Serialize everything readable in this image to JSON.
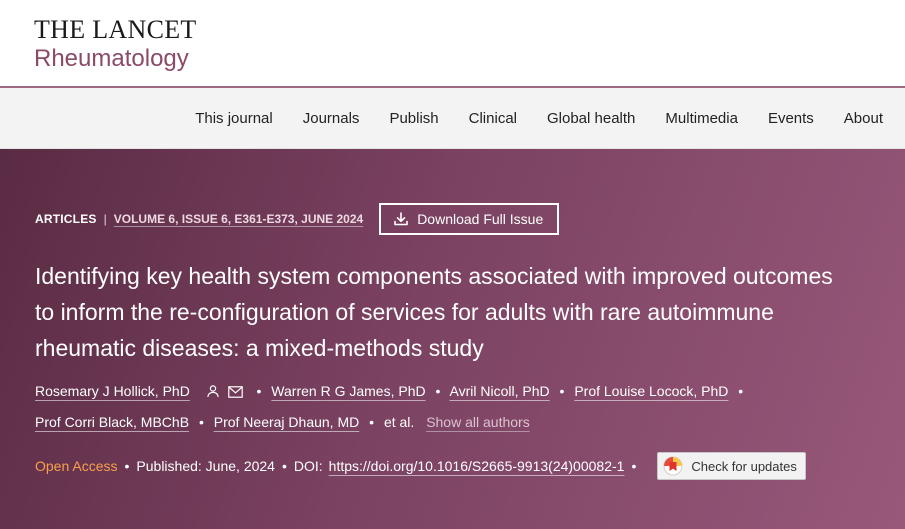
{
  "logo": {
    "top": "THE LANCET",
    "sub": "Rheumatology"
  },
  "nav": {
    "items": [
      "This journal",
      "Journals",
      "Publish",
      "Clinical",
      "Global health",
      "Multimedia",
      "Events",
      "About"
    ]
  },
  "article": {
    "type": "ARTICLES",
    "issue": "VOLUME 6, ISSUE 6, E361-E373, JUNE 2024",
    "download_label": "Download Full Issue",
    "title": "Identifying key health system components associated with improved outcomes to inform the re-configuration of services for adults with rare autoimmune rheumatic diseases: a mixed-methods study",
    "authors": [
      "Rosemary J Hollick, PhD",
      "Warren R G James, PhD",
      "Avril Nicoll, PhD",
      "Prof Louise Locock, PhD",
      "Prof Corri Black, MBChB",
      "Prof Neeraj Dhaun, MD"
    ],
    "et_al": "et al.",
    "show_all": "Show all authors",
    "open_access": "Open Access",
    "published": "Published: June, 2024",
    "doi_label": "DOI:",
    "doi": "https://doi.org/10.1016/S2665-9913(24)00082-1",
    "check_updates": "Check for updates"
  },
  "colors": {
    "brand": "#8a4a68",
    "hero_start": "#5a2b43",
    "hero_end": "#98587a",
    "open_access": "#f7a04b"
  },
  "icons": {
    "download": "download-icon",
    "person": "person-icon",
    "email": "email-icon",
    "check_updates": "crossmark-icon"
  }
}
